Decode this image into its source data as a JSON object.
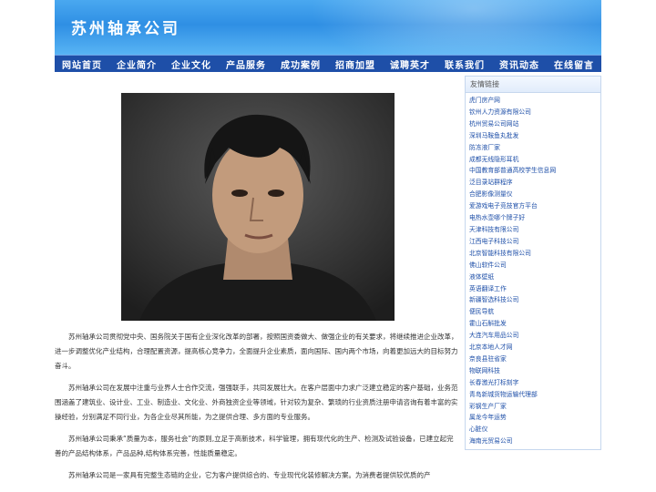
{
  "site": {
    "title": "苏州轴承公司"
  },
  "nav": {
    "items": [
      "网站首页",
      "企业简介",
      "企业文化",
      "产品服务",
      "成功案例",
      "招商加盟",
      "诚聘英才",
      "联系我们",
      "资讯动态",
      "在线留言"
    ]
  },
  "sidebar": {
    "title": "友情链接",
    "links": [
      "虎门房产网",
      "钦州人力资源有限公司",
      "杭州贸易公司网站",
      "深圳马鞍鱼丸批发",
      "防冻液厂家",
      "成都无线隐形耳机",
      "中国教育部普通高校学生信息网",
      "泛目录站群程序",
      "合肥影像测量仪",
      "爱游戏电子竞技官方平台",
      "电热水壶哪个牌子好",
      "天津科技有限公司",
      "江西电子科技公司",
      "北京智能科技有限公司",
      "佛山软件公司",
      "液体壁纸",
      "英语翻译工作",
      "新疆智选科技公司",
      "便民导航",
      "霍山石斛批发",
      "大连汽车用品公司",
      "北京本地人才网",
      "奈良县驻省家",
      "物联网科技",
      "长春激光打标刻字",
      "青岛新城货物运输代理部",
      "彩钢生产厂家",
      "属龙今年运势",
      "心脏仪",
      "海南光贸易公司"
    ]
  },
  "article": {
    "paragraphs": [
      "苏州轴承公司贯彻党中央、国务院关于国有企业深化改革的部署，按照国资委做大、做强企业的有关要求，将继续推进企业改革，进一步调整优化产业结构，合理配置资源，提高核心竞争力，全面提升企业素质，面向国际、国内两个市场，向着更加远大的目标努力奋斗。",
      "苏州轴承公司在发展中注重与业界人士合作交流，强强联手，共同发展壮大。在客户层面中力求广泛建立稳定的客户基础，业务范围涵盖了建筑业、设计业、工业、制造业、文化业、外商独资企业等领域，针对较为复杂、繁琐的行业资质注册申请咨询有着丰富的实操经验，分别满足不同行业，为各企业尽其所能，为之提供合理、多方面的专业服务。",
      "苏州轴承公司秉承“质量为本，服务社会”的原则,立足于高新技术，科学管理，拥有现代化的生产、检测及试验设备，已建立起完善的产品结构体系，产品品种,结构体系完善，性能质量稳定。",
      "苏州轴承公司是一家具有完整生态链的企业，它为客户提供综合的、专业现代化装修解决方案。为消费者提供较优质的产"
    ]
  },
  "colors": {
    "header": "#2f8fe4",
    "nav": "#1e4fa8",
    "link": "#1e4fa8"
  }
}
